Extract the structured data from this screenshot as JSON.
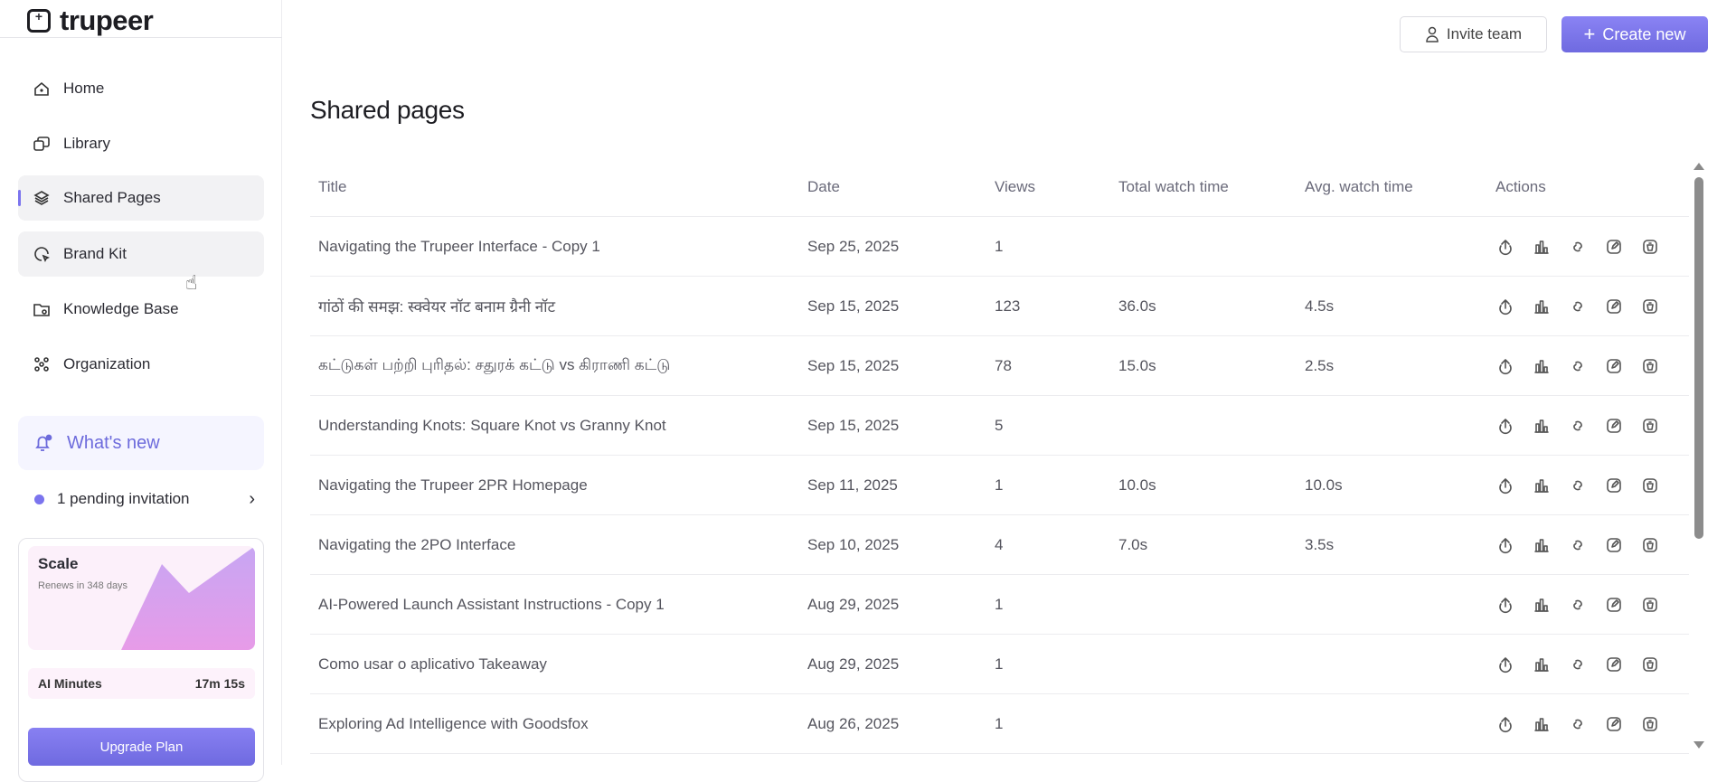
{
  "brand": {
    "name": "trupeer"
  },
  "sidebar": {
    "items": [
      {
        "label": "Home",
        "icon": "home-icon"
      },
      {
        "label": "Library",
        "icon": "library-icon"
      },
      {
        "label": "Shared Pages",
        "icon": "layers-icon"
      },
      {
        "label": "Brand Kit",
        "icon": "brand-kit-icon"
      },
      {
        "label": "Knowledge Base",
        "icon": "folder-icon"
      },
      {
        "label": "Organization",
        "icon": "people-icon"
      }
    ],
    "active": "Shared Pages",
    "whats_new": "What's new",
    "pending": "1 pending invitation",
    "plan": {
      "name": "Scale",
      "renews": "Renews in 348 days",
      "ai_minutes_label": "AI Minutes",
      "ai_minutes_value": "17m 15s",
      "upgrade": "Upgrade Plan"
    }
  },
  "header": {
    "invite": "Invite team",
    "create": "Create new"
  },
  "page": {
    "title": "Shared pages"
  },
  "table": {
    "columns": [
      "Title",
      "Date",
      "Views",
      "Total watch time",
      "Avg. watch time",
      "Actions"
    ],
    "rows": [
      [
        "Navigating the Trupeer Interface - Copy 1",
        "Sep 25, 2025",
        "1",
        "",
        ""
      ],
      [
        "गांठों की समझ: स्क्वेयर नॉट बनाम ग्रैनी नॉट",
        "Sep 15, 2025",
        "123",
        "36.0s",
        "4.5s"
      ],
      [
        "கட்டுகள் பற்றி புரிதல்: சதுரக் கட்டு vs கிராணி கட்டு",
        "Sep 15, 2025",
        "78",
        "15.0s",
        "2.5s"
      ],
      [
        "Understanding Knots: Square Knot vs Granny Knot",
        "Sep 15, 2025",
        "5",
        "",
        ""
      ],
      [
        "Navigating the Trupeer 2PR Homepage",
        "Sep 11, 2025",
        "1",
        "10.0s",
        "10.0s"
      ],
      [
        "Navigating the 2PO Interface",
        "Sep 10, 2025",
        "4",
        "7.0s",
        "3.5s"
      ],
      [
        "AI-Powered Launch Assistant Instructions - Copy 1",
        "Aug 29, 2025",
        "1",
        "",
        ""
      ],
      [
        "Como usar o aplicativo Takeaway",
        "Aug 29, 2025",
        "1",
        "",
        ""
      ],
      [
        "Exploring Ad Intelligence with Goodsfox",
        "Aug 26, 2025",
        "1",
        "",
        ""
      ]
    ],
    "actions": [
      "share-icon",
      "analytics-icon",
      "link-icon",
      "edit-icon",
      "delete-icon"
    ]
  },
  "colors": {
    "accent": "#7b74ee",
    "text": "#2b2b33"
  }
}
